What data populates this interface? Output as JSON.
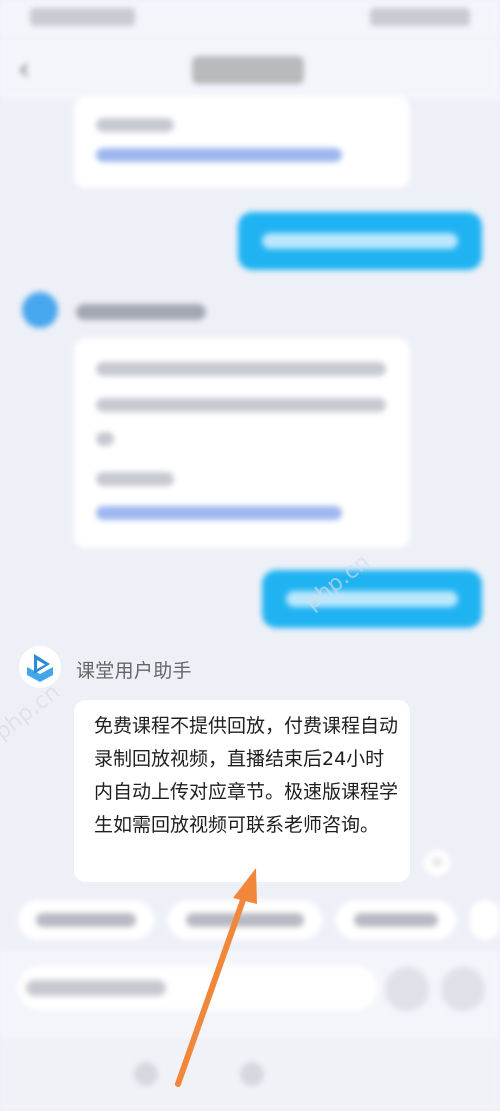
{
  "conversation": {
    "assistant_name": "课堂用户助手",
    "assistant_answer": "免费课程不提供回放，付费课程自动录制回放视频，直播结束后24小时内自动上传对应章节。极速版课程学生如需回放视频可联系老师咨询。"
  },
  "icons": {
    "back": "chevron-left-icon",
    "assistant_avatar": "play-book-icon",
    "copy": "copy-icon",
    "annotation": "arrow-annotation"
  },
  "colors": {
    "background": "#eef0f8",
    "user_bubble": "#20b3f2",
    "annotation_arrow": "#f0873a"
  }
}
